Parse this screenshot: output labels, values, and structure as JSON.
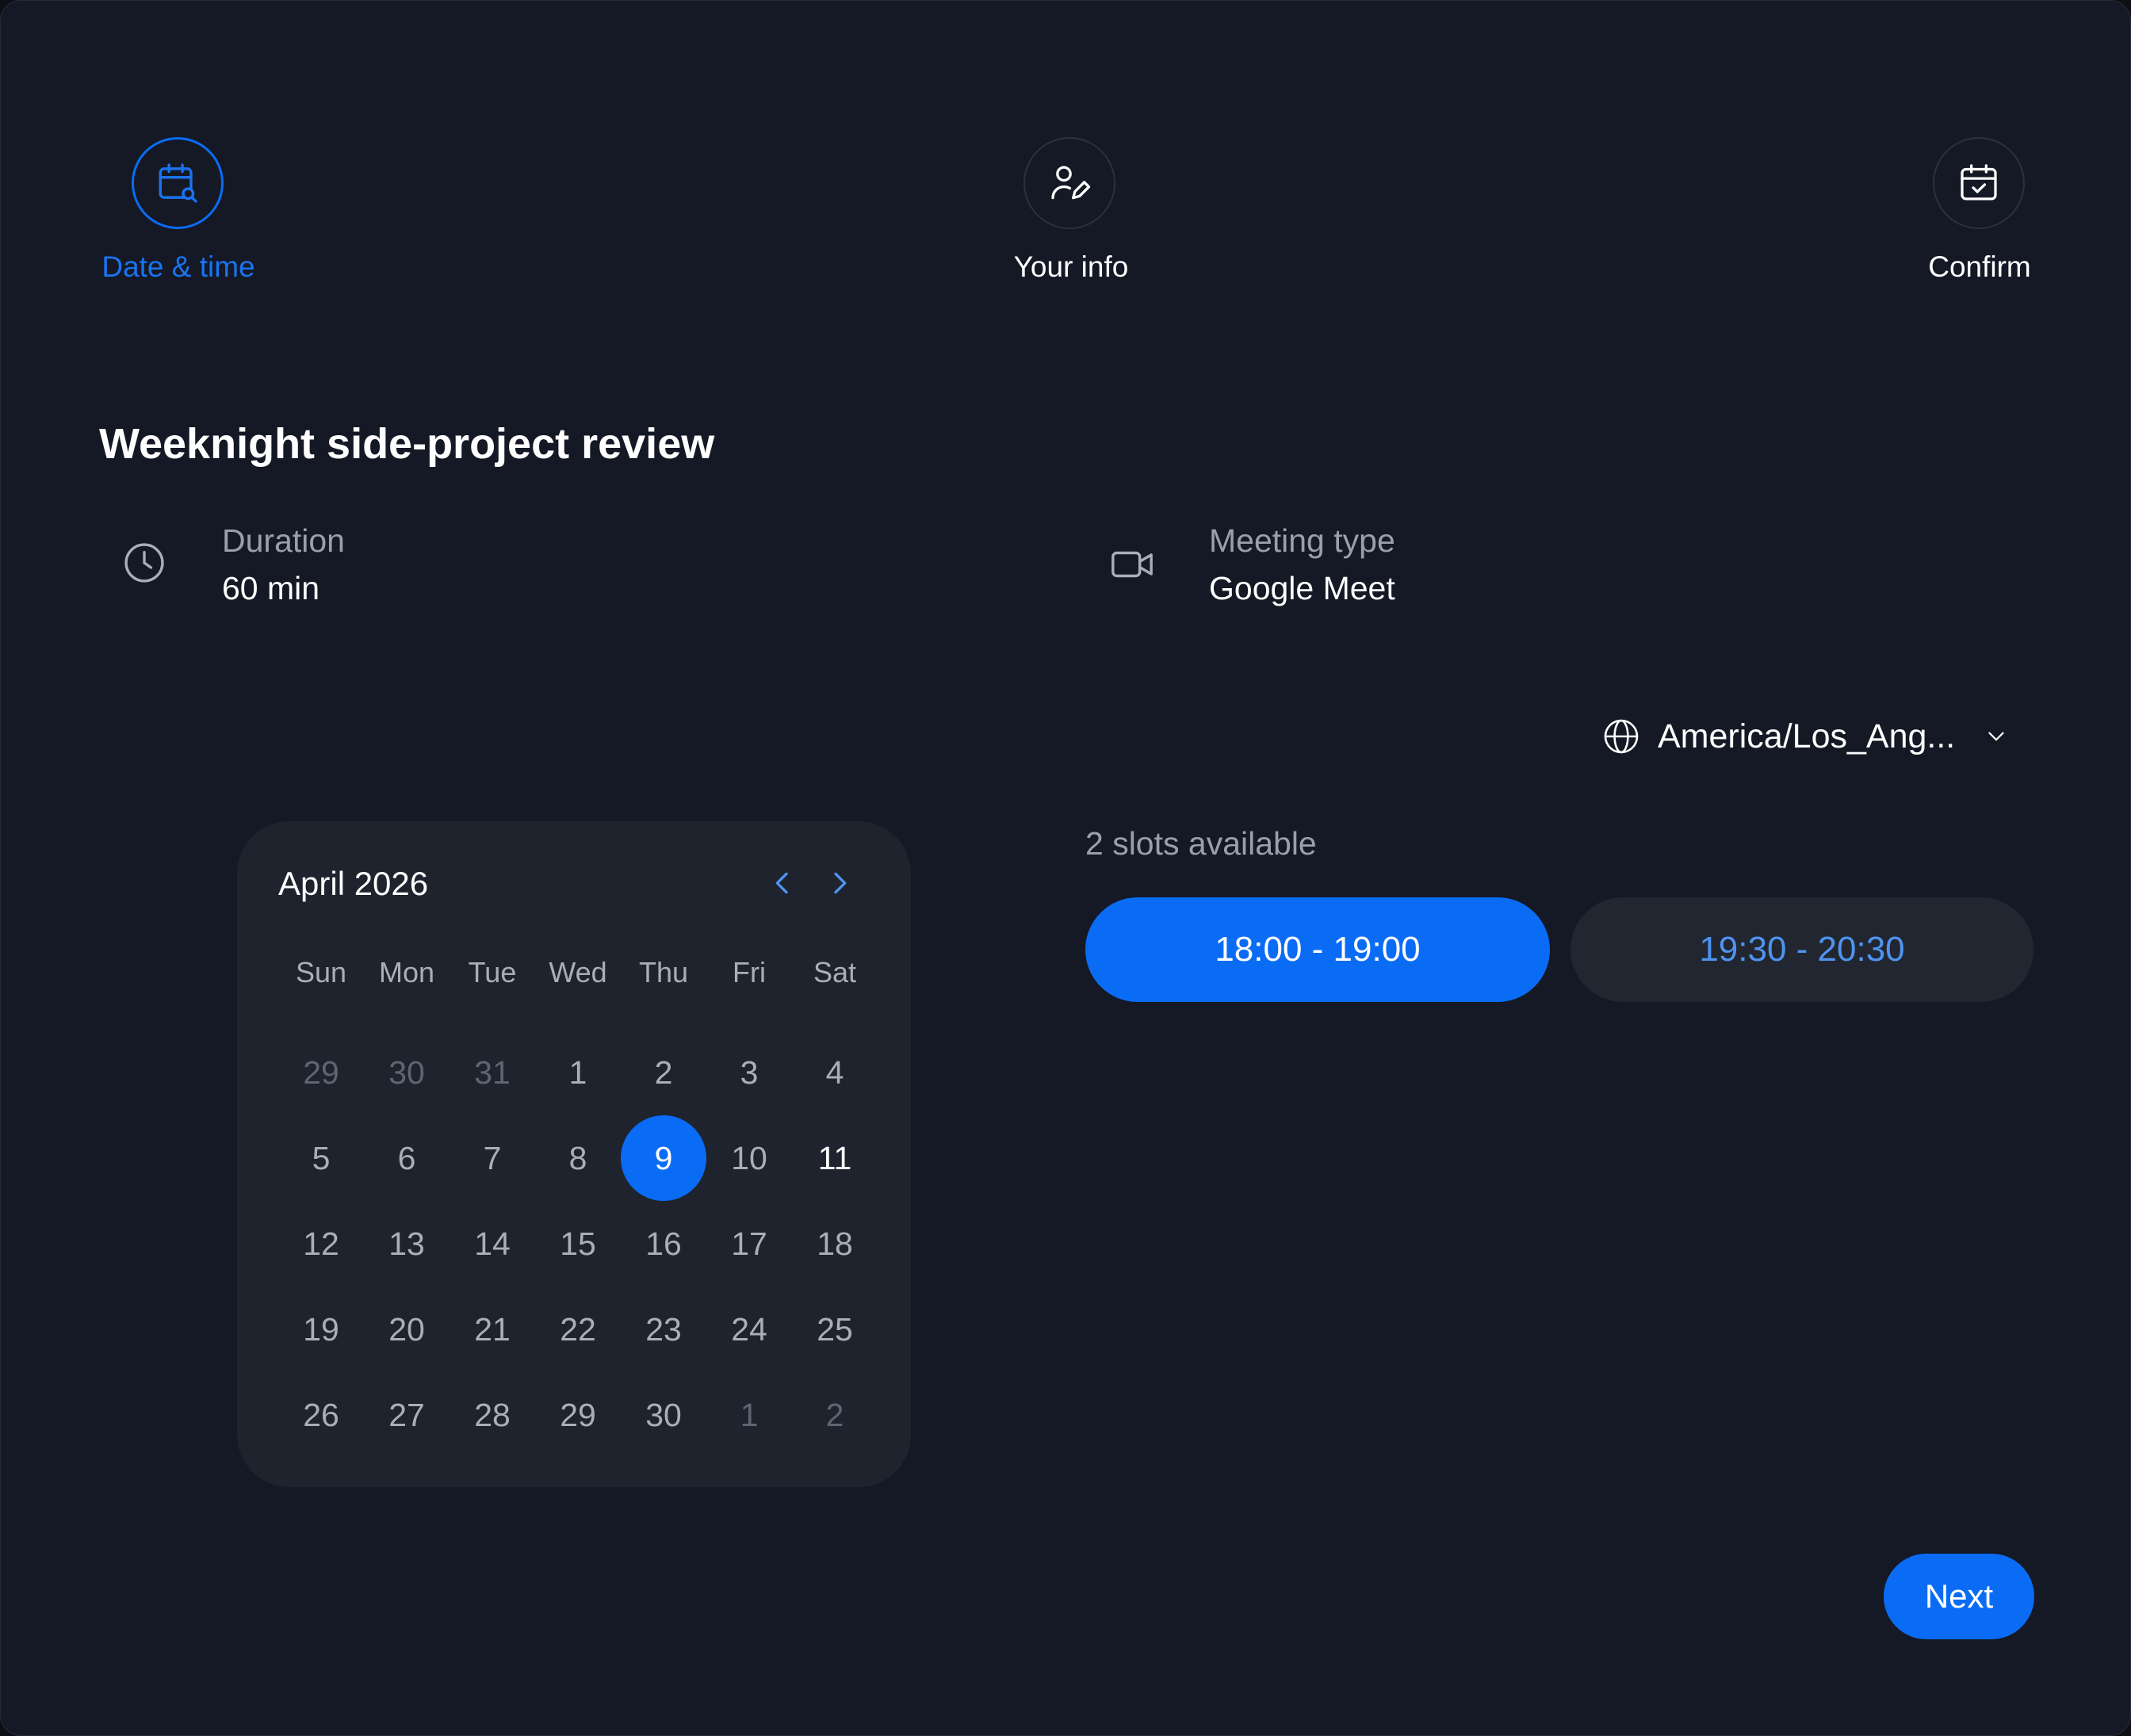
{
  "stepper": {
    "steps": [
      {
        "label": "Date & time",
        "icon": "calendar-search-icon",
        "active": true
      },
      {
        "label": "Your info",
        "icon": "user-edit-icon",
        "active": false
      },
      {
        "label": "Confirm",
        "icon": "calendar-check-icon",
        "active": false
      }
    ]
  },
  "event": {
    "title": "Weeknight side-project review",
    "duration_label": "Duration",
    "duration_value": "60 min",
    "meeting_type_label": "Meeting type",
    "meeting_type_value": "Google Meet"
  },
  "timezone": {
    "value": "America/Los_Ang...",
    "icon": "globe-icon"
  },
  "calendar": {
    "month": "April 2026",
    "weekdays": [
      "Sun",
      "Mon",
      "Tue",
      "Wed",
      "Thu",
      "Fri",
      "Sat"
    ],
    "days": [
      {
        "d": "29",
        "s": "muted"
      },
      {
        "d": "30",
        "s": "muted"
      },
      {
        "d": "31",
        "s": "muted"
      },
      {
        "d": "1",
        "s": ""
      },
      {
        "d": "2",
        "s": ""
      },
      {
        "d": "3",
        "s": ""
      },
      {
        "d": "4",
        "s": ""
      },
      {
        "d": "5",
        "s": ""
      },
      {
        "d": "6",
        "s": ""
      },
      {
        "d": "7",
        "s": ""
      },
      {
        "d": "8",
        "s": ""
      },
      {
        "d": "9",
        "s": "selected"
      },
      {
        "d": "10",
        "s": ""
      },
      {
        "d": "11",
        "s": "bold"
      },
      {
        "d": "12",
        "s": ""
      },
      {
        "d": "13",
        "s": ""
      },
      {
        "d": "14",
        "s": ""
      },
      {
        "d": "15",
        "s": ""
      },
      {
        "d": "16",
        "s": ""
      },
      {
        "d": "17",
        "s": ""
      },
      {
        "d": "18",
        "s": ""
      },
      {
        "d": "19",
        "s": ""
      },
      {
        "d": "20",
        "s": ""
      },
      {
        "d": "21",
        "s": ""
      },
      {
        "d": "22",
        "s": ""
      },
      {
        "d": "23",
        "s": ""
      },
      {
        "d": "24",
        "s": ""
      },
      {
        "d": "25",
        "s": ""
      },
      {
        "d": "26",
        "s": ""
      },
      {
        "d": "27",
        "s": ""
      },
      {
        "d": "28",
        "s": ""
      },
      {
        "d": "29",
        "s": ""
      },
      {
        "d": "30",
        "s": ""
      },
      {
        "d": "1",
        "s": "muted"
      },
      {
        "d": "2",
        "s": "muted"
      }
    ]
  },
  "slots": {
    "count_label": "2 slots available",
    "items": [
      {
        "label": "18:00 - 19:00",
        "selected": true
      },
      {
        "label": "19:30 - 20:30",
        "selected": false
      }
    ]
  },
  "actions": {
    "next_label": "Next"
  },
  "colors": {
    "accent": "#0a6cf5",
    "background": "#141925",
    "card": "#1f232d"
  }
}
